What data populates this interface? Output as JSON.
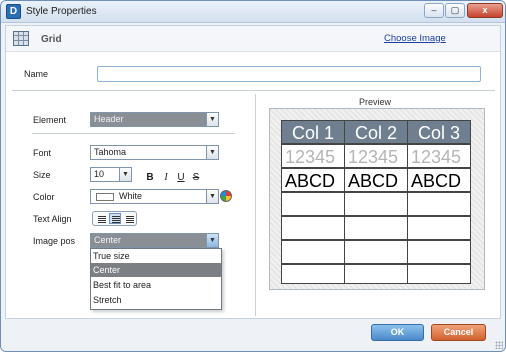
{
  "window": {
    "title": "Style Properties",
    "app_icon_glyph": "D",
    "minimize_glyph": "–",
    "maximize_glyph": "▢",
    "close_glyph": "x"
  },
  "header": {
    "section_title": "Grid",
    "choose_image_link": "Choose Image"
  },
  "name_field": {
    "label": "Name",
    "value": ""
  },
  "properties": {
    "element": {
      "label": "Element",
      "value": "Header"
    },
    "font": {
      "label": "Font",
      "value": "Tahoma"
    },
    "size": {
      "label": "Size",
      "value": "10"
    },
    "format_buttons": {
      "bold": "B",
      "italic": "I",
      "underline": "U",
      "strike": "S"
    },
    "color": {
      "label": "Color",
      "value": "White",
      "swatch": "#ffffff"
    },
    "text_align": {
      "label": "Text Align",
      "selected": "center"
    },
    "image_pos": {
      "label": "Image pos",
      "value": "Center",
      "options": [
        "True size",
        "Center",
        "Best fit to area",
        "Stretch"
      ],
      "selected_index": 1
    }
  },
  "preview": {
    "label": "Preview",
    "headers": [
      "Col 1",
      "Col 2",
      "Col 3"
    ],
    "number_row": [
      "12345",
      "12345",
      "12345"
    ],
    "text_row": [
      "ABCD",
      "ABCD",
      "ABCD"
    ],
    "empty_rows": 4,
    "header_color": "#6f7f8f"
  },
  "footer": {
    "ok_label": "OK",
    "cancel_label": "Cancel"
  }
}
